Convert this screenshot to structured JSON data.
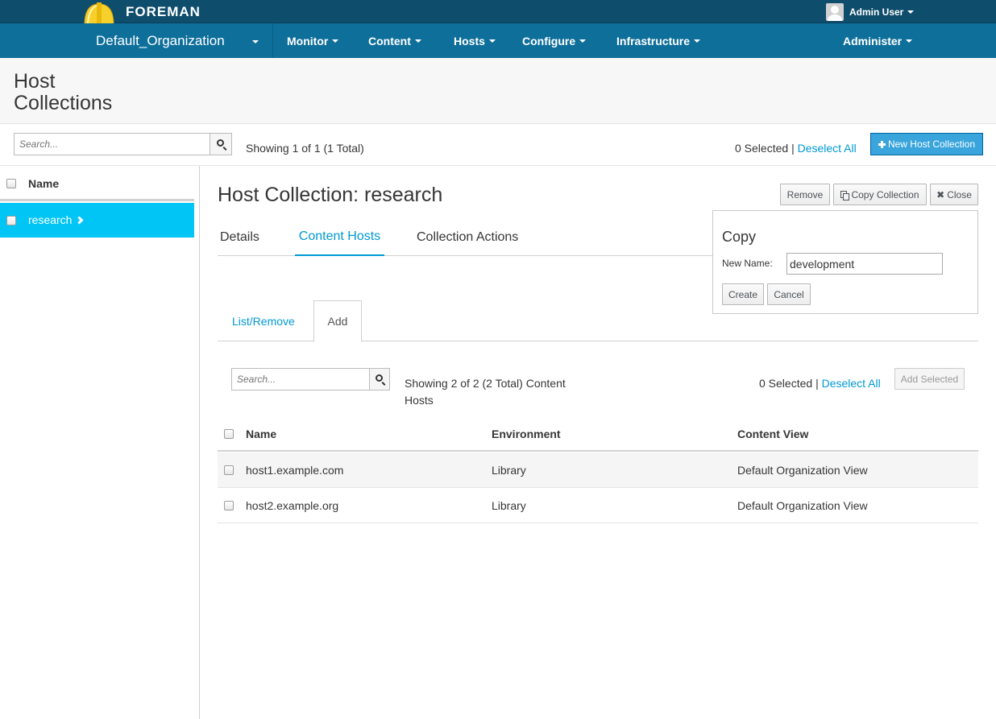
{
  "brand": {
    "name": "FOREMAN"
  },
  "user": {
    "name": "Admin User"
  },
  "nav": {
    "organization": "Default_Organization",
    "items": [
      "Monitor",
      "Content",
      "Hosts",
      "Configure",
      "Infrastructure",
      "Administer"
    ]
  },
  "page": {
    "title": "Host Collections"
  },
  "toolbar": {
    "search_placeholder": "Search...",
    "showing": "Showing 1 of 1 (1 Total)",
    "selected": "0 Selected",
    "separator": "|",
    "deselect_all": "Deselect All",
    "new_button": "New Host Collection"
  },
  "list": {
    "header_name": "Name",
    "items": [
      {
        "name": "research"
      }
    ]
  },
  "detail": {
    "title": "Host Collection: research",
    "buttons": {
      "remove": "Remove",
      "copy": "Copy Collection",
      "close": "Close"
    },
    "tabs": [
      "Details",
      "Content Hosts",
      "Collection Actions"
    ],
    "active_tab": "Content Hosts"
  },
  "copy_panel": {
    "title": "Copy",
    "label": "New Name:",
    "value": "development",
    "create": "Create",
    "cancel": "Cancel"
  },
  "content_hosts": {
    "subtabs": [
      "List/Remove",
      "Add"
    ],
    "active_subtab": "Add",
    "search_placeholder": "Search...",
    "showing_line1": "Showing 2 of 2 (2 Total) Content",
    "showing_line2": "Hosts",
    "selected": "0 Selected",
    "separator": "|",
    "deselect_all": "Deselect All",
    "add_selected": "Add Selected",
    "columns": [
      "Name",
      "Environment",
      "Content View"
    ],
    "rows": [
      {
        "name": "host1.example.com",
        "environment": "Library",
        "content_view": "Default Organization View"
      },
      {
        "name": "host2.example.org",
        "environment": "Library",
        "content_view": "Default Organization View"
      }
    ]
  },
  "colors": {
    "topbar": "#0e4d6c",
    "navbar": "#0e6f9a",
    "selected_row": "#00c5f5",
    "link": "#0099d3",
    "primary_button": "#39a5dc"
  }
}
